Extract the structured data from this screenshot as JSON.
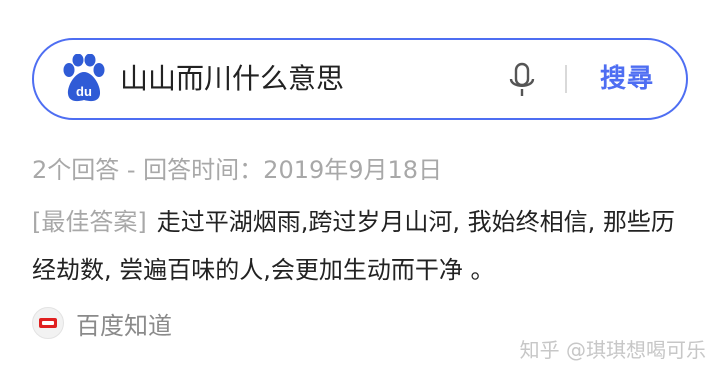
{
  "search": {
    "query": "山山而川什么意思",
    "button_label": "搜尋",
    "logo_icon": "baidu-paw-logo",
    "mic_icon": "microphone-icon",
    "accent_color": "#4e6ef2"
  },
  "result": {
    "meta": "2个回答 - 回答时间：2019年9月18日",
    "tag": "[最佳答案]",
    "answer_text": "走过平湖烟雨,跨过岁月山河, 我始终相信, 那些历经劫数, 尝遍百味的人,会更加生动而干净 。",
    "source_name": "百度知道",
    "source_icon": "baidu-zhidao-logo"
  },
  "watermark": "知乎 @琪琪想喝可乐"
}
